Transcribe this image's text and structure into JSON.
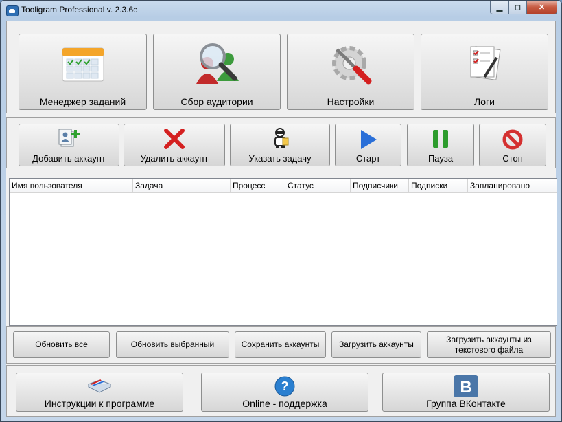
{
  "window": {
    "title": "Tooligram Professional v. 2.3.6c",
    "controls": {
      "minimize": "▁",
      "maximize": "◻",
      "close": "✕"
    }
  },
  "main_nav": [
    {
      "label": "Менеджер заданий",
      "icon": "calendar-icon"
    },
    {
      "label": "Сбор аудитории",
      "icon": "audience-search-icon"
    },
    {
      "label": "Настройки",
      "icon": "settings-icon"
    },
    {
      "label": "Логи",
      "icon": "logs-icon"
    }
  ],
  "toolbar": [
    {
      "label": "Добавить аккаунт",
      "icon": "add-account-icon"
    },
    {
      "label": "Удалить аккаунт",
      "icon": "delete-icon"
    },
    {
      "label": "Указать задачу",
      "icon": "task-robot-icon"
    },
    {
      "label": "Старт",
      "icon": "play-icon"
    },
    {
      "label": "Пауза",
      "icon": "pause-icon"
    },
    {
      "label": "Стоп",
      "icon": "stop-icon"
    }
  ],
  "accounts_table": {
    "columns": [
      "Имя пользователя",
      "Задача",
      "Процесс",
      "Статус",
      "Подписчики",
      "Подписки",
      "Запланировано"
    ],
    "rows": []
  },
  "actions": [
    {
      "label": "Обновить все"
    },
    {
      "label": "Обновить выбранный"
    },
    {
      "label": "Сохранить аккаунты"
    },
    {
      "label": "Загрузить аккаунты"
    },
    {
      "label": "Загрузить аккаунты из текстового файла"
    }
  ],
  "footer": [
    {
      "label": "Инструкции к программе",
      "icon": "book-icon"
    },
    {
      "label": "Online - поддержка",
      "icon": "help-icon"
    },
    {
      "label": "Группа ВКонтакте",
      "icon": "vk-logo-icon",
      "icon_text": "B"
    }
  ],
  "colors": {
    "accent": "#2f6fb3",
    "delete": "#d42020",
    "play": "#2a6fd8",
    "pause": "#2d9c2d",
    "stop": "#d43030",
    "vk": "#4a76a8"
  }
}
